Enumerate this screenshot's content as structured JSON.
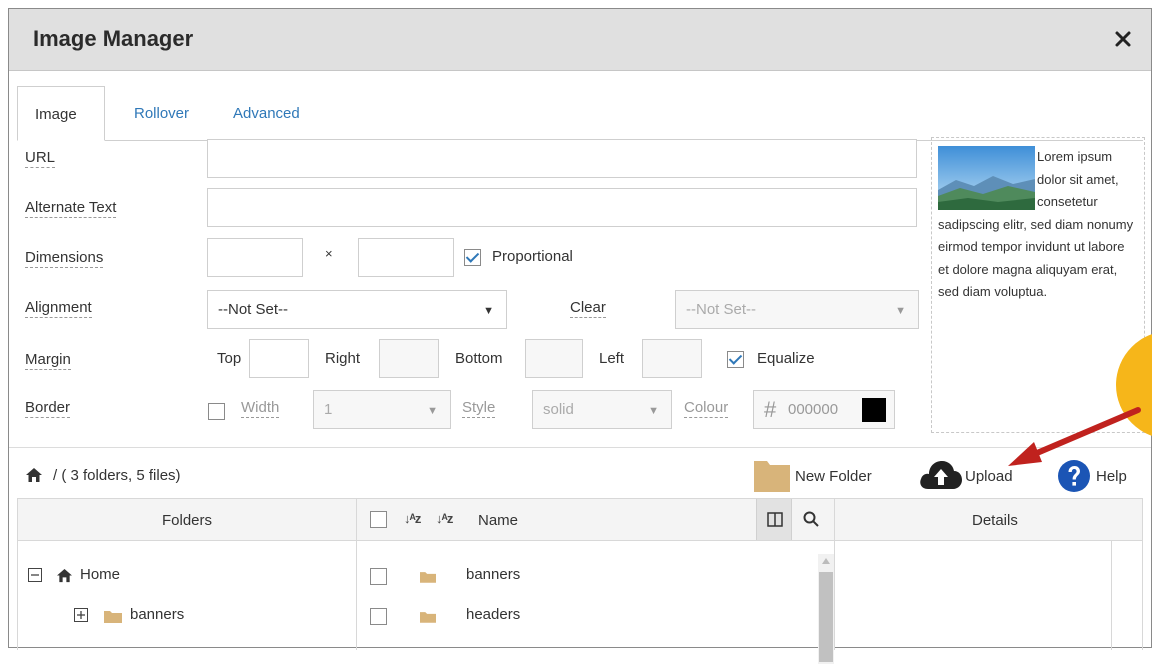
{
  "dialog": {
    "title": "Image Manager"
  },
  "tabs": [
    {
      "label": "Image",
      "active": true
    },
    {
      "label": "Rollover",
      "active": false
    },
    {
      "label": "Advanced",
      "active": false
    }
  ],
  "form": {
    "url_label": "URL",
    "url_value": "",
    "alt_label": "Alternate Text",
    "alt_value": "",
    "dimensions_label": "Dimensions",
    "dimensions_times": "×",
    "width_value": "",
    "height_value": "",
    "proportional_label": "Proportional",
    "proportional_checked": true,
    "alignment_label": "Alignment",
    "alignment_value": "--Not Set--",
    "clear_label": "Clear",
    "clear_value": "--Not Set--",
    "margin_label": "Margin",
    "margin_top_label": "Top",
    "margin_right_label": "Right",
    "margin_bottom_label": "Bottom",
    "margin_left_label": "Left",
    "equalize_label": "Equalize",
    "equalize_checked": true,
    "border_label": "Border",
    "border_width_label": "Width",
    "border_width_value": "1",
    "border_style_label": "Style",
    "border_style_value": "solid",
    "border_colour_label": "Colour",
    "border_colour_hash": "#",
    "border_colour_value": "000000",
    "border_colour_swatch": "#000000"
  },
  "preview": {
    "text": "Lorem ipsum dolor sit amet, consetetur sadipscing elitr, sed diam nonumy eirmod tempor invidunt ut labore et dolore magna aliquyam erat, sed diam voluptua."
  },
  "filebar": {
    "path": "/ ( 3 folders, 5 files)",
    "new_folder": "New Folder",
    "upload": "Upload",
    "help": "Help"
  },
  "grid": {
    "folders_header": "Folders",
    "name_header": "Name",
    "details_header": "Details",
    "tree": [
      {
        "label": "Home",
        "expander": "−"
      },
      {
        "label": "banners",
        "expander": "+"
      }
    ],
    "files": [
      {
        "name": "banners"
      },
      {
        "name": "headers"
      }
    ]
  },
  "colors": {
    "link": "#2f78b8",
    "folder": "#d8b47a",
    "annotation_arrow": "#c0221e",
    "annotation_circle": "#f6b61a",
    "help_icon": "#1b55b5"
  }
}
